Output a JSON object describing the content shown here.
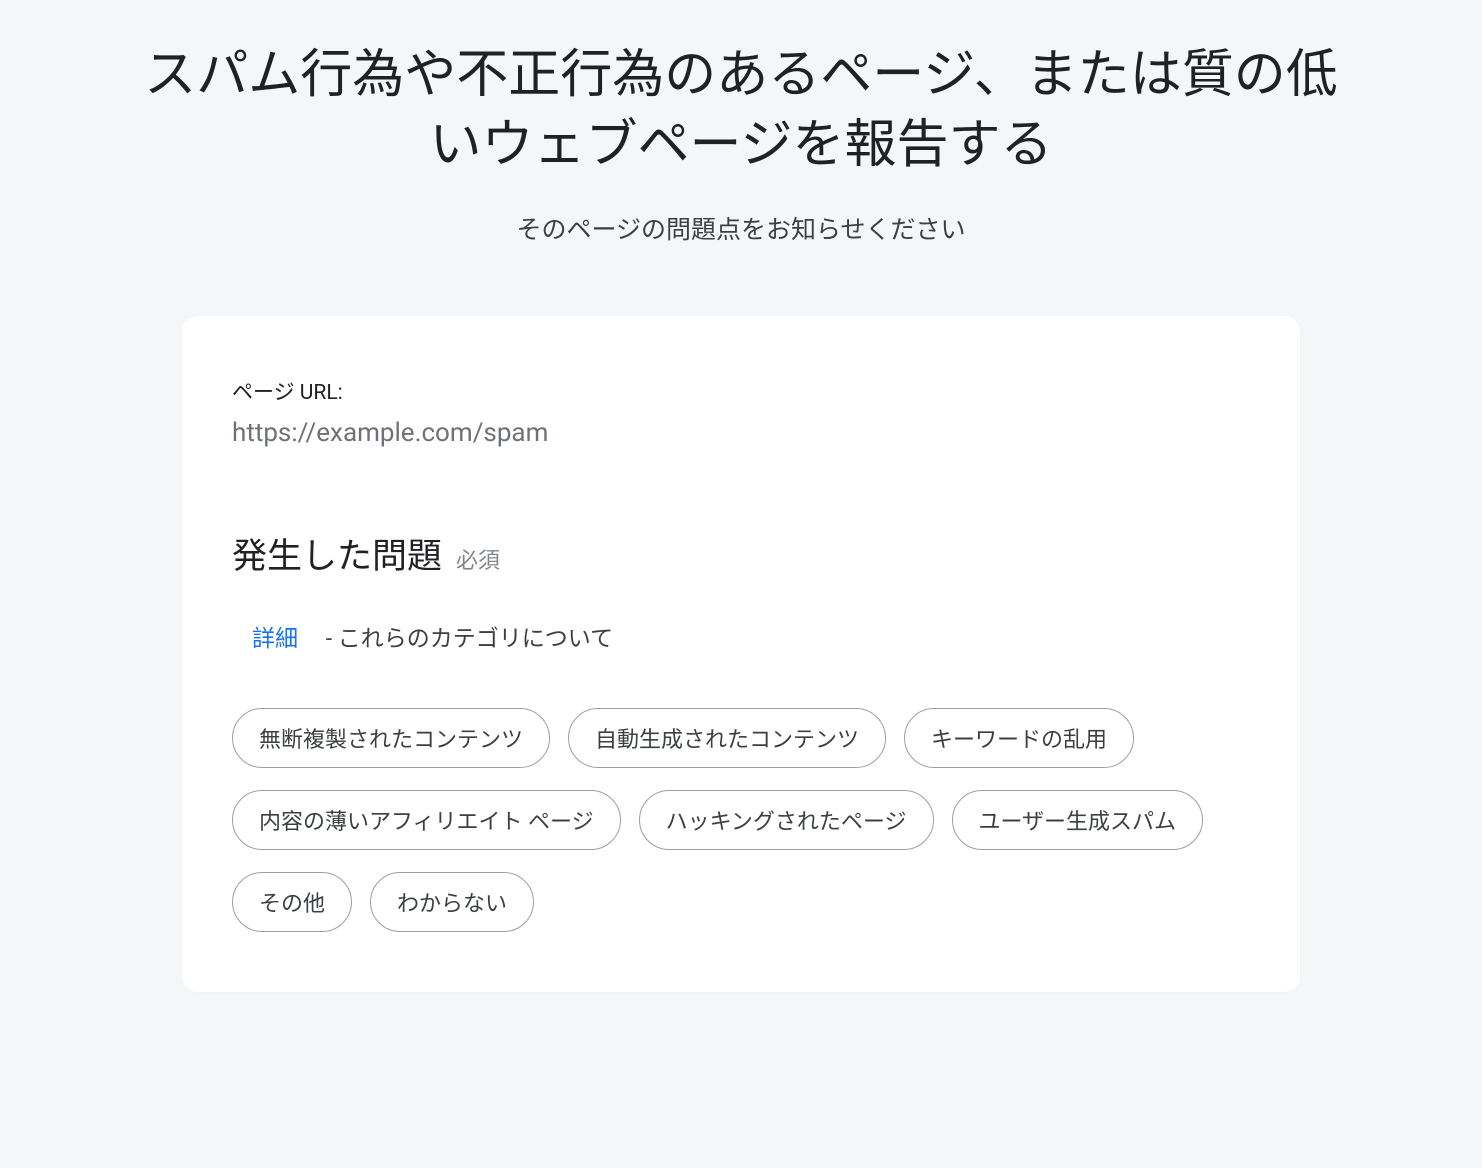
{
  "header": {
    "title": "スパム行為や不正行為のあるページ、または質の低いウェブページを報告する",
    "subtitle": "そのページの問題点をお知らせください"
  },
  "form": {
    "url_field": {
      "label": "ページ URL:",
      "value": "https://example.com/spam"
    },
    "problem_section": {
      "heading": "発生した問題",
      "required_label": "必須",
      "details_link_text": "詳細",
      "details_suffix": "- これらのカテゴリについて"
    },
    "violation_chips": [
      "無断複製されたコンテンツ",
      "自動生成されたコンテンツ",
      "キーワードの乱用",
      "内容の薄いアフィリエイト ページ",
      "ハッキングされたページ",
      "ユーザー生成スパム",
      "その他",
      "わからない"
    ]
  }
}
